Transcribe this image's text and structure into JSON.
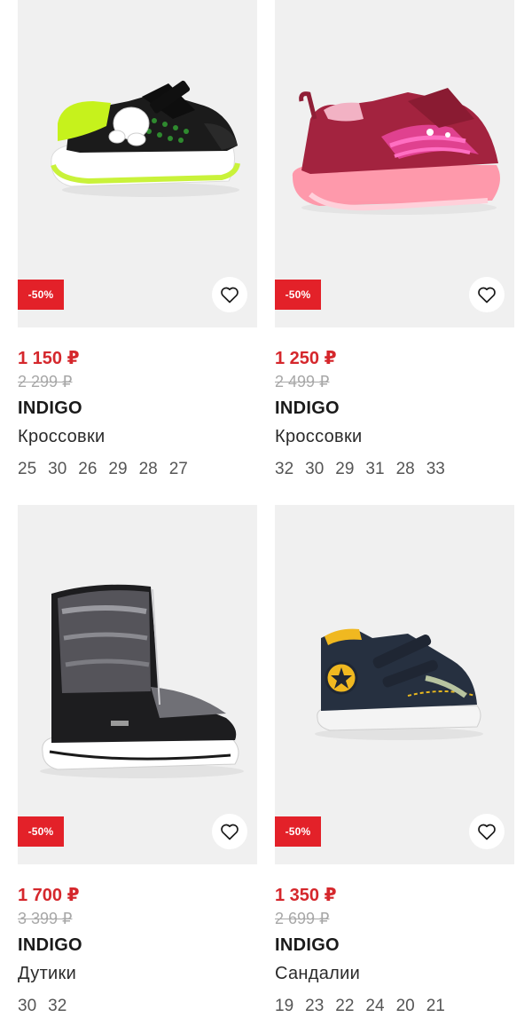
{
  "products": [
    {
      "discount": "-50%",
      "price": "1 150 ₽",
      "old_price": "2 299 ₽",
      "brand": "INDIGO",
      "name": "Кроссовки",
      "sizes": [
        "25",
        "30",
        "26",
        "29",
        "28",
        "27"
      ],
      "image": "sneaker-neon-green-icon"
    },
    {
      "discount": "-50%",
      "price": "1 250 ₽",
      "old_price": "2 499 ₽",
      "brand": "INDIGO",
      "name": "Кроссовки",
      "sizes": [
        "32",
        "30",
        "29",
        "31",
        "28",
        "33"
      ],
      "image": "sneaker-pink-lightup-icon"
    },
    {
      "discount": "-50%",
      "price": "1 700 ₽",
      "old_price": "3 399 ₽",
      "brand": "INDIGO",
      "name": "Дутики",
      "sizes": [
        "30",
        "32"
      ],
      "image": "boot-black-silver-icon"
    },
    {
      "discount": "-50%",
      "price": "1 350 ₽",
      "old_price": "2 699 ₽",
      "brand": "INDIGO",
      "name": "Сандалии",
      "sizes": [
        "19",
        "23",
        "22",
        "24",
        "20",
        "21"
      ],
      "image": "sandal-navy-yellow-icon"
    }
  ],
  "colors": {
    "discount_badge": "#e32129",
    "price": "#d5272c",
    "old_price": "#a8a8a8",
    "photo_bg": "#f0f0f0"
  },
  "icons": {
    "favorite": "heart-outline-icon"
  }
}
